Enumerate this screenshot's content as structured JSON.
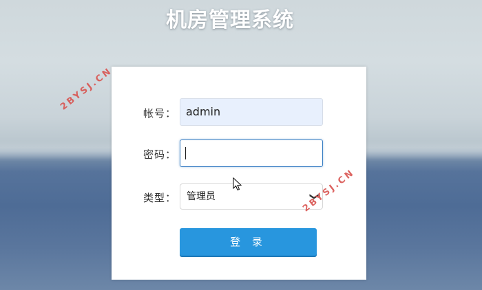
{
  "page": {
    "title": "机房管理系统"
  },
  "form": {
    "account": {
      "label": "帐号：",
      "value": "admin"
    },
    "password": {
      "label": "密码：",
      "value": ""
    },
    "type": {
      "label": "类型：",
      "selected": "管理员"
    },
    "submit_label": "登 录"
  },
  "watermarks": [
    "2BYSJ.CN",
    "2BYSJ.CN"
  ],
  "colors": {
    "button": "#2896de",
    "focus_border": "#3b7fc4",
    "autofill_bg": "#e8f0fd",
    "watermark": "#d9534f"
  }
}
